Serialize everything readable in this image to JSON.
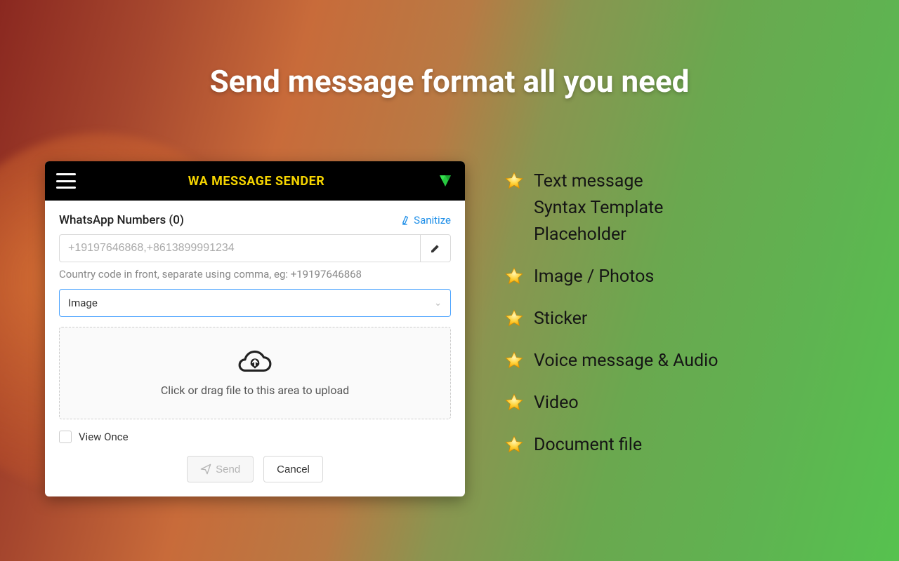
{
  "page_title": "Send message format all you need",
  "panel": {
    "header_title": "WA MESSAGE SENDER",
    "numbers_label": "WhatsApp Numbers (0)",
    "sanitize_link": "Sanitize",
    "phone_placeholder": "+19197646868,+8613899991234",
    "hint": "Country code in front, separate using comma, eg: +19197646868",
    "select_value": "Image",
    "dropzone_text": "Click or drag file to this area to upload",
    "view_once_label": "View Once",
    "send_label": "Send",
    "cancel_label": "Cancel"
  },
  "features": [
    "Text message\nSyntax Template\nPlaceholder",
    "Image / Photos",
    "Sticker",
    "Voice message & Audio",
    "Video",
    "Document file"
  ]
}
